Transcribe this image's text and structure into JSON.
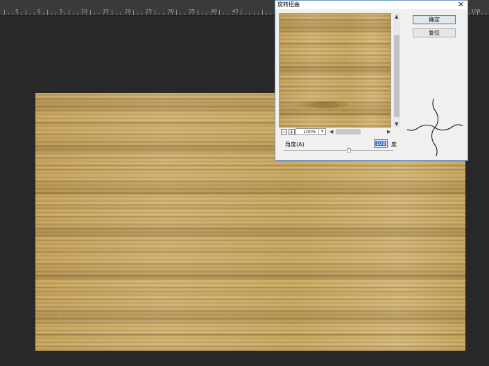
{
  "ruler": {
    "labels": [
      "5",
      "0",
      "5",
      "10",
      "15",
      "20",
      "25",
      "30",
      "35",
      "40",
      "45",
      "100"
    ]
  },
  "dialog": {
    "title": "旋转扭曲",
    "close_glyph": "✕",
    "ok_label": "确定",
    "reset_label": "复位",
    "zoom_minus": "−",
    "zoom_plus": "+",
    "zoom_value": "100%",
    "angle_label": "角度(A)",
    "angle_value": "100",
    "angle_unit": "度"
  },
  "colors": {
    "canvas_bg": "#282828",
    "ruler_bg": "#3a3a3a",
    "dialog_bg": "#f0f0f0",
    "ok_border": "#3c7fb1",
    "wood": "#c8a865"
  },
  "icons": {
    "close": "close-icon",
    "scroll_up": "arrow-up-icon",
    "scroll_down": "arrow-down-icon",
    "scroll_left": "arrow-left-icon",
    "scroll_right": "arrow-right-icon",
    "dropdown": "chevron-down-icon",
    "slider": "slider-handle-icon",
    "twirl": "twirl-preview-icon"
  }
}
